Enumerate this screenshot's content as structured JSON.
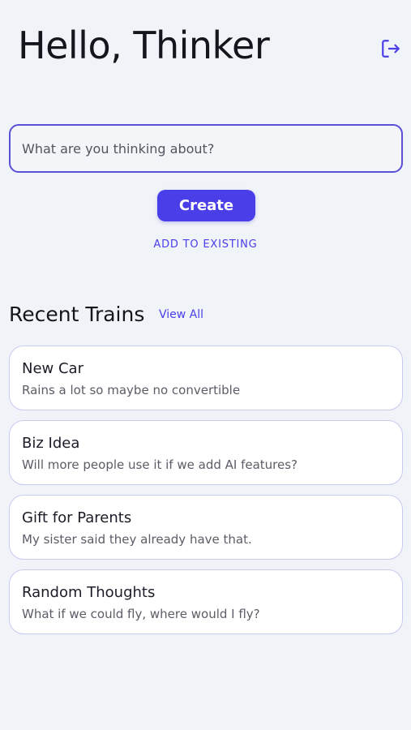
{
  "header": {
    "greeting": "Hello, Thinker",
    "logout_icon": "logout-icon"
  },
  "composer": {
    "placeholder": "What are you thinking about?",
    "value": "",
    "create_label": "Create",
    "add_existing_label": "ADD TO EXISTING"
  },
  "recent": {
    "title": "Recent Trains",
    "view_all_label": "View All",
    "items": [
      {
        "title": "New Car",
        "note": "Rains a lot so maybe no convertible"
      },
      {
        "title": "Biz Idea",
        "note": "Will more people use it if we add AI features?"
      },
      {
        "title": "Gift for Parents",
        "note": "My sister said they already have that."
      },
      {
        "title": "Random Thoughts",
        "note": "What if we could fly, where would I fly?"
      }
    ]
  },
  "colors": {
    "accent": "#4a3ee8",
    "background": "#f0f3f7",
    "card_border": "#c9c9f2"
  }
}
